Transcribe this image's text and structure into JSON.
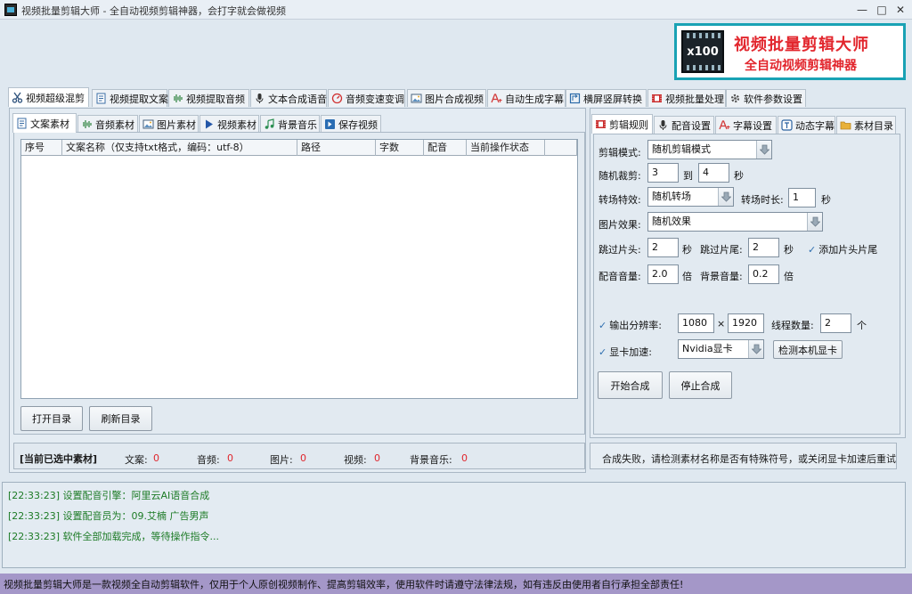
{
  "window": {
    "title": "视频批量剪辑大师 - 全自动视频剪辑神器，会打字就会做视频",
    "min_icon": "minimize-icon",
    "max_icon": "maximize-icon",
    "close_icon": "close-icon"
  },
  "banner": {
    "badge": "x100",
    "title": "视频批量剪辑大师",
    "subtitle": "全自动视频剪辑神器"
  },
  "main_tabs": [
    {
      "label": "视频超级混剪",
      "icon": "scissors-icon"
    },
    {
      "label": "视频提取文案",
      "icon": "document-icon"
    },
    {
      "label": "视频提取音频",
      "icon": "waveform-icon"
    },
    {
      "label": "文本合成语音",
      "icon": "microphone-icon"
    },
    {
      "label": "音频变速变调",
      "icon": "gauge-icon"
    },
    {
      "label": "图片合成视频",
      "icon": "image-icon"
    },
    {
      "label": "自动生成字幕",
      "icon": "font-icon"
    },
    {
      "label": "横屏竖屏转换",
      "icon": "rotate-icon"
    },
    {
      "label": "视频批量处理",
      "icon": "film-icon"
    },
    {
      "label": "软件参数设置",
      "icon": "gear-icon"
    }
  ],
  "left_tabs": [
    {
      "label": "文案素材",
      "icon": "document-icon"
    },
    {
      "label": "音频素材",
      "icon": "waveform-icon"
    },
    {
      "label": "图片素材",
      "icon": "image-icon"
    },
    {
      "label": "视频素材",
      "icon": "play-icon"
    },
    {
      "label": "背景音乐",
      "icon": "music-icon"
    },
    {
      "label": "保存视频",
      "icon": "save-icon"
    }
  ],
  "table": {
    "columns": [
      "序号",
      "文案名称（仅支持txt格式，编码：utf-8）",
      "路径",
      "字数",
      "配音",
      "当前操作状态"
    ],
    "rows": []
  },
  "left_buttons": {
    "open_dir": "打开目录",
    "refresh_dir": "刷新目录"
  },
  "selected": {
    "title": "[当前已选中素材]",
    "items": [
      {
        "label": "文案:",
        "value": "0"
      },
      {
        "label": "音频:",
        "value": "0"
      },
      {
        "label": "图片:",
        "value": "0"
      },
      {
        "label": "视频:",
        "value": "0"
      },
      {
        "label": "背景音乐:",
        "value": "0"
      }
    ]
  },
  "right_tabs": [
    {
      "label": "剪辑规则",
      "icon": "film-icon"
    },
    {
      "label": "配音设置",
      "icon": "microphone-icon"
    },
    {
      "label": "字幕设置",
      "icon": "font-icon"
    },
    {
      "label": "动态字幕",
      "icon": "text-box-icon"
    },
    {
      "label": "素材目录",
      "icon": "folder-icon"
    }
  ],
  "rules": {
    "mode_label": "剪辑模式:",
    "mode_value": "随机剪辑模式",
    "cut_label": "随机裁剪:",
    "cut_from": "3",
    "cut_to_label": "到",
    "cut_to": "4",
    "seconds": "秒",
    "transition_label": "转场特效:",
    "transition_value": "随机转场",
    "transition_dur_label": "转场时长:",
    "transition_dur": "1",
    "image_effect_label": "图片效果:",
    "image_effect_value": "随机效果",
    "skip_head_label": "跳过片头:",
    "skip_head": "2",
    "skip_tail_label": "跳过片尾:",
    "skip_tail": "2",
    "add_head_tail": "添加片头片尾",
    "dub_volume_label": "配音音量:",
    "dub_volume": "2.0",
    "times": "倍",
    "bg_volume_label": "背景音量:",
    "bg_volume": "0.2",
    "resolution_label": "输出分辨率:",
    "res_w": "1080",
    "res_x": "×",
    "res_h": "1920",
    "threads_label": "线程数量:",
    "threads": "2",
    "threads_unit": "个",
    "gpu_label": "显卡加速:",
    "gpu_value": "Nvidia显卡",
    "detect_gpu": "检测本机显卡",
    "start": "开始合成",
    "stop": "停止合成"
  },
  "status_message": "合成失败，请检测素材名称是否有特殊符号，或关闭显卡加速后重试",
  "log": [
    "[22:33:23] 设置配音引擎：阿里云AI语音合成",
    "[22:33:23] 设置配音员为：09.艾楠 广告男声",
    "[22:33:23] 软件全部加载完成，等待操作指令..."
  ],
  "footer": "视频批量剪辑大师是一款视频全自动剪辑软件，仅用于个人原创视频制作、提高剪辑效率，使用软件时请遵守法律法规，如有违反由使用者自行承担全部责任!",
  "colors": {
    "accent": "#19a2b4",
    "brand_red": "#e2262d",
    "log_green": "#1d7b26",
    "footer_bg": "#a497c8"
  }
}
